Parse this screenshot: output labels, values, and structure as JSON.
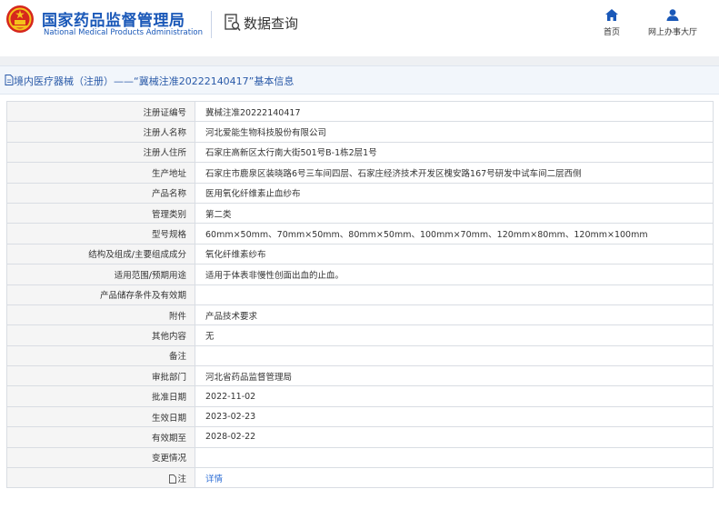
{
  "header": {
    "title_cn": "国家药品监督管理局",
    "title_en": "National Medical Products Administration",
    "query_label": "数据查询",
    "nav": {
      "home": "首页",
      "hall": "网上办事大厅"
    }
  },
  "titlebar": {
    "text": "境内医疗器械（注册）——“冀械注准20222140417”基本信息"
  },
  "rows": [
    {
      "label": "注册证编号",
      "value": "冀械注准20222140417"
    },
    {
      "label": "注册人名称",
      "value": "河北爱能生物科技股份有限公司"
    },
    {
      "label": "注册人住所",
      "value": "石家庄高新区太行南大街501号B-1栋2层1号"
    },
    {
      "label": "生产地址",
      "value": "石家庄市鹿泉区装晓路6号三车间四层、石家庄经济技术开发区槐安路167号研发中试车间二层西侧"
    },
    {
      "label": "产品名称",
      "value": "医用氧化纤维素止血纱布"
    },
    {
      "label": "管理类别",
      "value": "第二类"
    },
    {
      "label": "型号规格",
      "value": "60mm×50mm、70mm×50mm、80mm×50mm、100mm×70mm、120mm×80mm、120mm×100mm"
    },
    {
      "label": "结构及组成/主要组成成分",
      "value": "氧化纤维素纱布"
    },
    {
      "label": "适用范围/预期用途",
      "value": "适用于体表非慢性创面出血的止血。"
    },
    {
      "label": "产品储存条件及有效期",
      "value": ""
    },
    {
      "label": "附件",
      "value": "产品技术要求"
    },
    {
      "label": "其他内容",
      "value": "无"
    },
    {
      "label": "备注",
      "value": ""
    },
    {
      "label": "审批部门",
      "value": "河北省药品监督管理局"
    },
    {
      "label": "批准日期",
      "value": "2022-11-02"
    },
    {
      "label": "生效日期",
      "value": "2023-02-23"
    },
    {
      "label": "有效期至",
      "value": "2028-02-22"
    },
    {
      "label": "变更情况",
      "value": ""
    },
    {
      "label": "注",
      "value": "详情"
    }
  ],
  "colors": {
    "brand": "#1a58b8",
    "link": "#2f6fd6",
    "label_bg": "#f5f5f5",
    "titlebar_bg": "#f2f6fb"
  },
  "icons": {
    "emblem": "national-emblem-icon",
    "query": "document-search-icon",
    "home": "home-icon",
    "hall": "user-icon",
    "title": "document-icon",
    "note": "document-icon"
  }
}
